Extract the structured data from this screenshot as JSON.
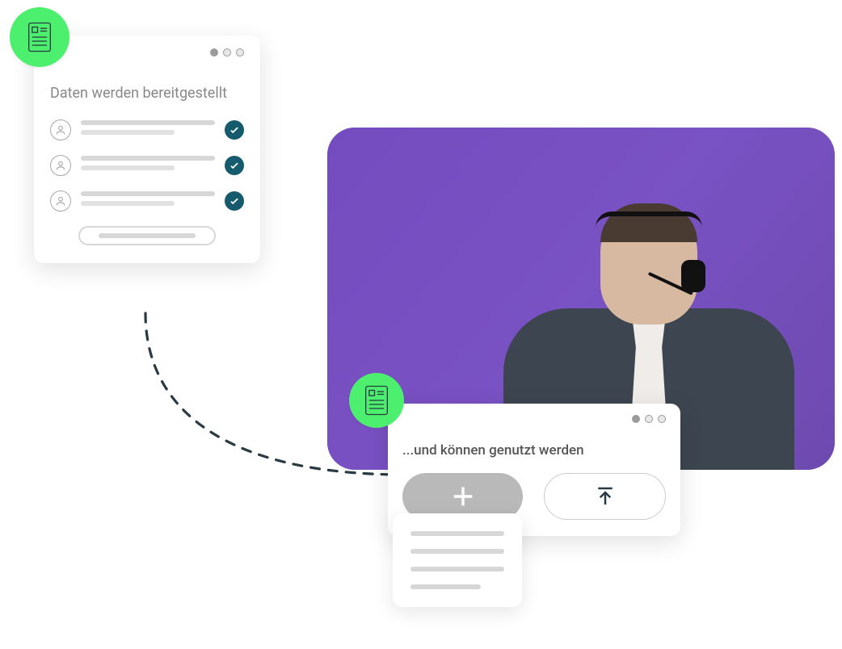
{
  "panel_left": {
    "title": "Daten werden bereitgestellt"
  },
  "panel_right": {
    "title": "...und können genutzt werden"
  }
}
